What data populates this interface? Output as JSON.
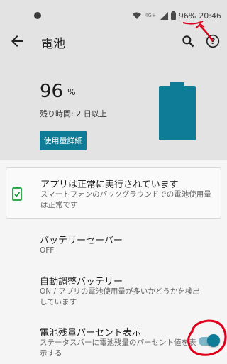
{
  "status_bar": {
    "network_label": "4G+",
    "battery_percent": "96%",
    "time": "20:46"
  },
  "app_bar": {
    "title": "電池"
  },
  "battery": {
    "level_value": "96",
    "level_unit": "%",
    "remaining": "残り時間: 2 日以上",
    "usage_button": "使用量詳細",
    "accent_color": "#0e7c96"
  },
  "status_card": {
    "title": "アプリは正常に実行されています",
    "description": "スマートフォンのバックグラウンドでの電池使用量は正常です"
  },
  "settings": {
    "battery_saver": {
      "title": "バッテリーセーバー",
      "subtitle": "OFF"
    },
    "adaptive_battery": {
      "title": "自動調整バッテリー",
      "subtitle": "ON / アプリの電池使用量が多いかどうかを検出しています"
    },
    "percent_display": {
      "title": "電池残量パーセント表示",
      "subtitle": "ステータスバーに電池残量のパーセント値を表示する",
      "enabled": true
    }
  },
  "annotation_color": "#e0001b"
}
